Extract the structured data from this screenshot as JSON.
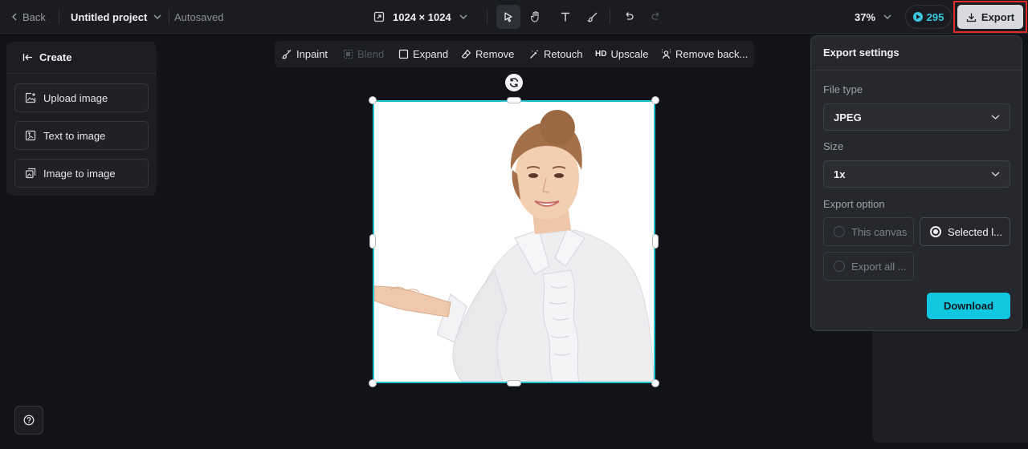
{
  "topbar": {
    "back_label": "Back",
    "project_title": "Untitled project",
    "autosave_status": "Autosaved",
    "canvas_size": "1024 × 1024",
    "zoom_level": "37%",
    "credits": "295",
    "export_label": "Export"
  },
  "left_panel": {
    "header": "Create",
    "items": [
      {
        "label": "Upload image",
        "icon": "upload-image-icon"
      },
      {
        "label": "Text to image",
        "icon": "text-to-image-icon"
      },
      {
        "label": "Image to image",
        "icon": "image-to-image-icon"
      }
    ]
  },
  "canvas_toolbar": {
    "items": [
      {
        "label": "Inpaint",
        "icon": "inpaint-icon",
        "enabled": true
      },
      {
        "label": "Blend",
        "icon": "blend-icon",
        "enabled": false
      },
      {
        "label": "Expand",
        "icon": "expand-icon",
        "enabled": true
      },
      {
        "label": "Remove",
        "icon": "eraser-icon",
        "enabled": true
      },
      {
        "label": "Retouch",
        "icon": "retouch-icon",
        "enabled": true
      },
      {
        "label": "Upscale",
        "icon_text": "HD",
        "enabled": true
      },
      {
        "label": "Remove back...",
        "icon": "remove-background-icon",
        "enabled": true
      }
    ]
  },
  "export_panel": {
    "title": "Export settings",
    "file_type_label": "File type",
    "file_type_value": "JPEG",
    "size_label": "Size",
    "size_value": "1x",
    "export_option_label": "Export option",
    "options": [
      {
        "label": "This canvas",
        "selected": false
      },
      {
        "label": "Selected l...",
        "selected": true
      },
      {
        "label": "Export all ...",
        "selected": false
      }
    ],
    "download_label": "Download"
  },
  "colors": {
    "accent": "#12c7e0",
    "selection_border": "#22c5cf",
    "highlight_box": "#e02b2b",
    "background": "#121318"
  }
}
